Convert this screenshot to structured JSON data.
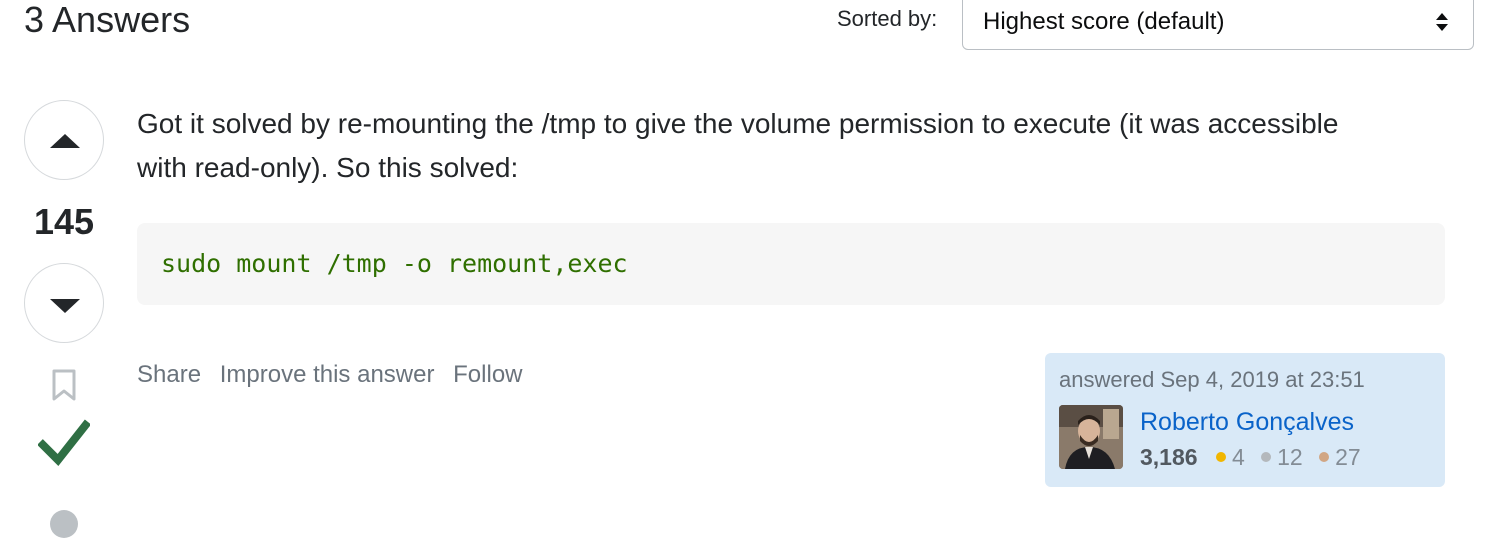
{
  "header": {
    "answer_count_text": "3 Answers",
    "sort_label": "Sorted by:",
    "sort_value": "Highest score (default)"
  },
  "answer": {
    "vote_count": "145",
    "accepted": true,
    "body_text": "Got it solved by re-mounting the /tmp to give the volume permission to execute (it was accessible with read-only). So this solved:",
    "code": "sudo mount /tmp -o remount,exec",
    "menu": {
      "share": "Share",
      "improve": "Improve this answer",
      "follow": "Follow"
    },
    "user_card": {
      "action_time": "answered Sep 4, 2019 at 23:51",
      "user_name": "Roberto Gonçalves",
      "reputation": "3,186",
      "gold_badges": "4",
      "silver_badges": "12",
      "bronze_badges": "27"
    }
  },
  "icons": {
    "vote_up": "caret-up-icon",
    "vote_down": "caret-down-icon",
    "bookmark": "bookmark-icon",
    "accepted": "checkmark-icon",
    "sort_arrows": "select-arrows-icon"
  },
  "colors": {
    "accepted_green": "#2f6f44",
    "link_blue": "#0a63c9",
    "code_green": "#2f6f00",
    "user_card_bg": "#d9e9f7"
  }
}
